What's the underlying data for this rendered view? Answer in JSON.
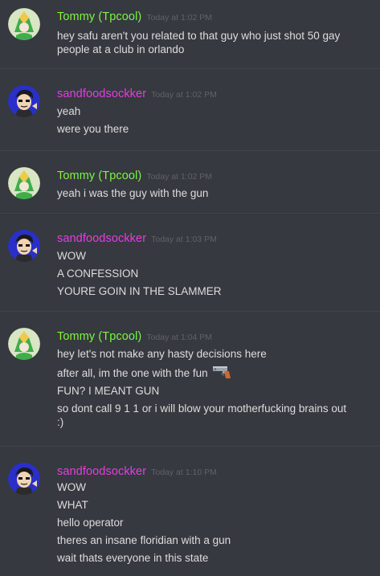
{
  "colors": {
    "background": "#36393f",
    "divider": "#40434a",
    "tommy_name": "#7bf545",
    "sand_name": "#e43ee0",
    "timestamp": "#5f6368",
    "text": "#dcddde"
  },
  "messages": [
    {
      "author": "Tommy (Tpcool)",
      "time": "Today at 1:02 PM",
      "lines": [
        "hey safu aren't you related to that guy who just shot 50 gay people at a club in orlando"
      ]
    },
    {
      "author": "sandfoodsockker",
      "time": "Today at 1:02 PM",
      "lines": [
        "yeah",
        "were you there"
      ]
    },
    {
      "author": "Tommy (Tpcool)",
      "time": "Today at 1:02 PM",
      "lines": [
        "yeah i was the guy with the gun"
      ]
    },
    {
      "author": "sandfoodsockker",
      "time": "Today at 1:03 PM",
      "lines": [
        "WOW",
        "A CONFESSION",
        "YOURE GOIN IN THE SLAMMER"
      ]
    },
    {
      "author": "Tommy (Tpcool)",
      "time": "Today at 1:04 PM",
      "lines": [
        "hey let's not make any hasty decisions here",
        "after all, im the one with the fun",
        "FUN? I MEANT GUN",
        "so dont call 9 1 1 or i will blow your motherfucking brains out :)"
      ],
      "emoji_after_line": 1,
      "emoji": "pistol-emoji"
    },
    {
      "author": "sandfoodsockker",
      "time": "Today at 1:10 PM",
      "lines": [
        "WOW",
        "WHAT",
        "hello operator",
        "theres an insane floridian with a gun",
        "wait thats everyone in this state"
      ]
    }
  ]
}
